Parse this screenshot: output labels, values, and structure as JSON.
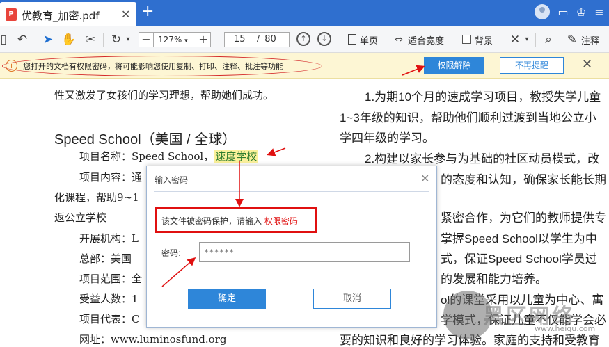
{
  "tab": {
    "title": "优教育_加密.pdf",
    "icon": "pdf-file-icon"
  },
  "toolbar": {
    "zoom": "127%",
    "page_current": "15",
    "page_separator": "/",
    "page_total": "80",
    "single_page": "单页",
    "fit_width": "适合宽度",
    "background": "背景",
    "annotate": "注释"
  },
  "notice": {
    "message": "您打开的文档有权限密码，将可能影响您使用复制、打印、注释、批注等功能",
    "unlock_button": "权限解除",
    "no_remind_button": "不再提醒"
  },
  "doc": {
    "left": [
      "性又激发了女孩们的学习理想，帮助她们成功。",
      "Speed School（美国 / 全球）",
      "项目名称：Speed School，",
      "速度学校",
      "项目内容：通",
      "化课程，帮助9~1",
      "返公立学校",
      "开展机构：L",
      "总部：美国",
      "项目范围：全",
      "受益人数：1",
      "项目代表：C",
      "网址：www.luminosfund.org"
    ],
    "right": [
      "1.为期10个月的速成学习项目，教授失学儿童",
      "1~3年级的知识，帮助他们顺利过渡到当地公立小",
      "学四年级的学习。",
      "2.构建以家长参与为基础的社区动员模式，改",
      "的态度和认知，确保家长能长期",
      "紧密合作，为它们的教师提供专",
      "掌握Speed School以学生为中",
      "式，保证Speed School学员过",
      "的发展和能力培养。",
      "ol的课堂采用以儿童为中心、寓",
      "学模式，保证儿童不仅能学会必",
      "要的知识和良好的学习体验。家庭的支持和受教育"
    ]
  },
  "dialog": {
    "title": "输入密码",
    "message_prefix": "该文件被密码保护，请输入",
    "message_highlight": "权限密码",
    "password_label": "密码:",
    "password_placeholder": "******",
    "ok": "确定",
    "cancel": "取消"
  },
  "watermark": {
    "text": "黑区网络",
    "url": "www.heiqu.com"
  },
  "colors": {
    "title_bar": "#2f6fcf",
    "accent": "#2e86d9",
    "annotation_red": "#e01010",
    "notice_bg": "#fdf6d4"
  }
}
